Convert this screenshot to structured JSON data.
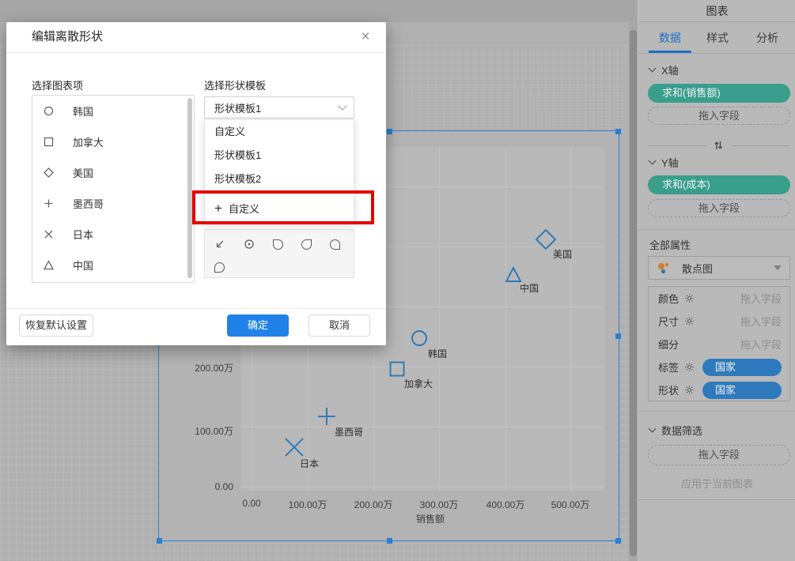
{
  "modal": {
    "title": "编辑离散形状",
    "close_glyph": "×",
    "left_label": "选择图表项",
    "right_label": "选择形状模板",
    "chart_items": [
      {
        "shape": "circle",
        "label": "韩国"
      },
      {
        "shape": "square",
        "label": "加拿大"
      },
      {
        "shape": "diamond",
        "label": "美国"
      },
      {
        "shape": "plus",
        "label": "墨西哥"
      },
      {
        "shape": "x",
        "label": "日本"
      },
      {
        "shape": "triangle",
        "label": "中国"
      }
    ],
    "template_select": {
      "value": "形状模板1"
    },
    "dropdown_options": [
      "自定义",
      "形状模板1",
      "形状模板2"
    ],
    "custom_option": {
      "plus": "+",
      "label": "自定义"
    },
    "buttons": {
      "restore": "恢复默认设置",
      "ok": "确定",
      "cancel": "取消"
    }
  },
  "sidebar": {
    "header": "图表",
    "tabs": [
      {
        "label": "数据",
        "active": true
      },
      {
        "label": "样式",
        "active": false
      },
      {
        "label": "分析",
        "active": false
      }
    ],
    "x_section": {
      "title": "X轴",
      "field": "求和(销售额)",
      "drop_placeholder": "拖入字段"
    },
    "y_section": {
      "title": "Y轴",
      "field": "求和(成本)",
      "drop_placeholder": "拖入字段"
    },
    "all_props_label": "全部属性",
    "chart_type": {
      "value": "散点图"
    },
    "property_rows": [
      {
        "label": "颜色",
        "has_gear": true,
        "value": "拖入字段",
        "kind": "placeholder"
      },
      {
        "label": "尺寸",
        "has_gear": true,
        "value": "拖入字段",
        "kind": "placeholder"
      },
      {
        "label": "细分",
        "has_gear": false,
        "value": "拖入字段",
        "kind": "placeholder"
      },
      {
        "label": "标签",
        "has_gear": true,
        "value": "国家",
        "kind": "field"
      },
      {
        "label": "形状",
        "has_gear": true,
        "value": "国家",
        "kind": "field"
      }
    ],
    "filter_section": {
      "title": "数据筛选",
      "drop_placeholder": "拖入字段",
      "apply_note": "应用于当前图表"
    }
  },
  "chart_data": {
    "type": "scatter",
    "xlabel": "销售额",
    "ylabel": "",
    "unit": "万",
    "x_tick_labels": [
      "0.00",
      "100.00万",
      "200.00万",
      "300.00万",
      "400.00万",
      "500.00万"
    ],
    "y_tick_labels": [
      "200.00万",
      "100.00万",
      "0.00"
    ],
    "xlim_wan": [
      0,
      550
    ],
    "ylim_wan": [
      0,
      560
    ],
    "grid": true,
    "points": [
      {
        "label": "日本",
        "shape": "x",
        "sales_wan": 65,
        "cost_wan": 65
      },
      {
        "label": "墨西哥",
        "shape": "plus",
        "sales_wan": 118,
        "cost_wan": 117
      },
      {
        "label": "加拿大",
        "shape": "square",
        "sales_wan": 228,
        "cost_wan": 196
      },
      {
        "label": "韩国",
        "shape": "circle",
        "sales_wan": 263,
        "cost_wan": 247
      },
      {
        "label": "中国",
        "shape": "triangle",
        "sales_wan": 411,
        "cost_wan": 353
      },
      {
        "label": "美国",
        "shape": "diamond",
        "sales_wan": 462,
        "cost_wan": 412
      }
    ]
  },
  "colors": {
    "accent_blue": "#2082e8",
    "selection_blue": "#2a7fd4",
    "field_green": "#3a9e8c",
    "field_blue": "#2f7abd",
    "marker_blue": "#2e7cb8",
    "annotation_red": "#e60000",
    "tab_active_blue": "#1e6ec6"
  }
}
